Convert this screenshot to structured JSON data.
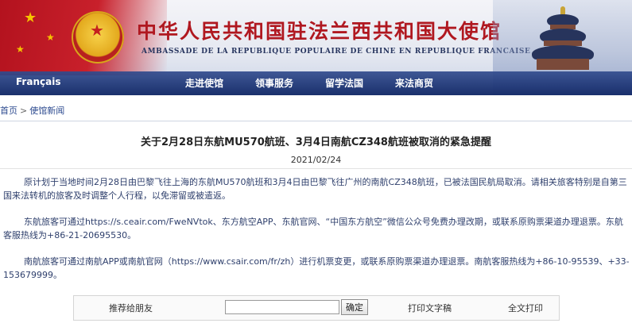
{
  "header": {
    "title_cn": "中华人民共和国驻法兰西共和国大使馆",
    "title_fr": "AMBASSADE DE LA REPUBLIQUE POPULAIRE DE CHINE EN REPUBLIQUE FRANCAISE"
  },
  "nav": {
    "lang": "Français",
    "items": [
      "走进使馆",
      "领事服务",
      "留学法国",
      "来法商贸"
    ]
  },
  "breadcrumb": {
    "home": "首页",
    "sep": ">",
    "section": "使馆新闻"
  },
  "article": {
    "title": "关于2月28日东航MU570航班、3月4日南航CZ348航班被取消的紧急提醒",
    "date": "2021/02/24",
    "paragraphs": [
      "原计划于当地时间2月28日由巴黎飞往上海的东航MU570航班和3月4日由巴黎飞往广州的南航CZ348航班，已被法国民航局取消。请相关旅客特别是自第三国来法转机的旅客及时调整个人行程，以免滞留或被遣返。",
      "东航旅客可通过https://s.ceair.com/FweNVtok、东方航空APP、东航官网、“中国东方航空”微信公众号免费办理改期，或联系原购票渠道办理退票。东航客服热线为+86-21-20695530。",
      "南航旅客可通过南航APP或南航官网（https://www.csair.com/fr/zh）进行机票变更，或联系原购票渠道办理退票。南航客服热线为+86-10-95539、+33-153679999。"
    ]
  },
  "toolbar": {
    "recommend_label": "推荐给朋友",
    "input_value": "",
    "confirm_label": "确定",
    "print_text_label": "打印文字稿",
    "print_full_label": "全文打印"
  },
  "colors": {
    "title_red": "#b01820",
    "nav_blue": "#233f8a",
    "body_text": "#2e3f6c"
  }
}
